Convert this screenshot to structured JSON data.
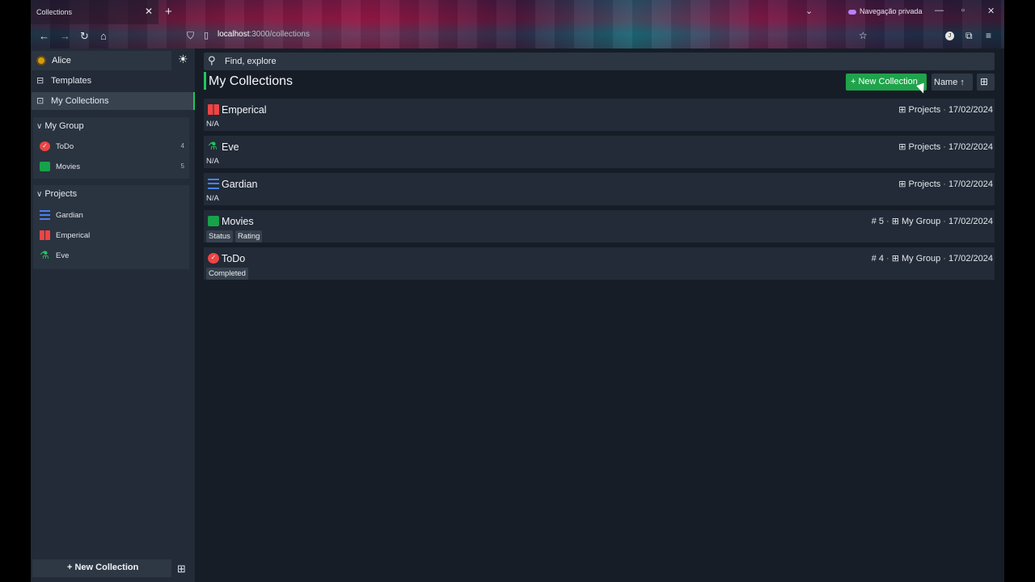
{
  "browser": {
    "tab_title": "Collections",
    "tab_close": "✕",
    "tab_new": "+",
    "url_host": "localhost",
    "url_path": ":3000/collections",
    "private_label": "Navegação privada",
    "avatar_letter": "J",
    "icons": [
      "back-icon",
      "forward-icon",
      "reload-icon",
      "home-icon",
      "shield-icon",
      "page-icon",
      "star-icon",
      "extensions-icon",
      "menu-icon"
    ]
  },
  "sidebar": {
    "user_name": "Alice",
    "theme_icon": "☀",
    "nav": [
      {
        "label": "Templates",
        "icon": "templates-icon"
      },
      {
        "label": "My Collections",
        "icon": "collections-icon",
        "active": true
      }
    ],
    "groups": [
      {
        "title": "My Group",
        "items": [
          {
            "label": "ToDo",
            "count": "4",
            "icon": "check-circle-icon"
          },
          {
            "label": "Movies",
            "count": "5",
            "icon": "video-icon"
          }
        ]
      },
      {
        "title": "Projects",
        "items": [
          {
            "label": "Gardian",
            "icon": "sliders-icon"
          },
          {
            "label": "Emperical",
            "icon": "book-icon"
          },
          {
            "label": "Eve",
            "icon": "flask-icon"
          }
        ]
      }
    ],
    "new_collection_label": "New Collection"
  },
  "main": {
    "search_placeholder": "Find, explore",
    "title": "My Collections",
    "new_collection_label": "New Collection",
    "sort_label": "Name",
    "collections": [
      {
        "name": "Emperical",
        "icon": "book-icon",
        "description": "N/A",
        "group": "Projects",
        "date": "17/02/2024"
      },
      {
        "name": "Eve",
        "icon": "flask-icon",
        "description": "N/A",
        "group": "Projects",
        "date": "17/02/2024"
      },
      {
        "name": "Gardian",
        "icon": "sliders-icon",
        "description": "N/A",
        "group": "Projects",
        "date": "17/02/2024"
      },
      {
        "name": "Movies",
        "icon": "video-icon",
        "count": "5",
        "group": "My Group",
        "date": "17/02/2024",
        "tags": [
          "Status",
          "Rating"
        ]
      },
      {
        "name": "ToDo",
        "icon": "check-circle-icon",
        "count": "4",
        "group": "My Group",
        "date": "17/02/2024",
        "tags": [
          "Completed"
        ]
      }
    ]
  },
  "colors": {
    "accent": "#22c55e",
    "button_green": "#1fa34b",
    "background": "#161d27",
    "sidebar": "#222b37"
  }
}
